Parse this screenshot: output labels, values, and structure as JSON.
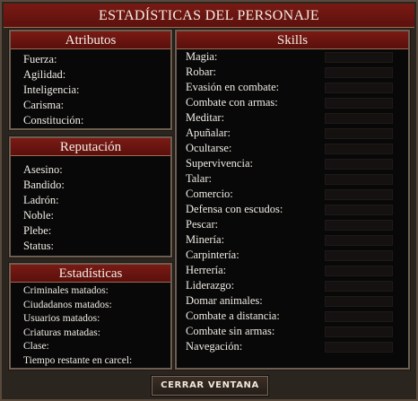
{
  "window": {
    "title": "ESTADÍSTICAS DEL PERSONAJE"
  },
  "attributes": {
    "title": "Atributos",
    "items": [
      {
        "label": "Fuerza:"
      },
      {
        "label": "Agilidad:"
      },
      {
        "label": "Inteligencia:"
      },
      {
        "label": "Carisma:"
      },
      {
        "label": "Constitución:"
      }
    ]
  },
  "reputation": {
    "title": "Reputación",
    "items": [
      {
        "label": "Asesino:"
      },
      {
        "label": "Bandido:"
      },
      {
        "label": "Ladrón:"
      },
      {
        "label": "Noble:"
      },
      {
        "label": "Plebe:"
      },
      {
        "label": "Status:"
      }
    ]
  },
  "statistics": {
    "title": "Estadísticas",
    "items": [
      {
        "label": "Criminales matados:"
      },
      {
        "label": "Ciudadanos matados:"
      },
      {
        "label": "Usuarios matados:"
      },
      {
        "label": "Criaturas matadas:"
      },
      {
        "label": "Clase:"
      },
      {
        "label": "Tiempo restante en carcel:"
      }
    ]
  },
  "skills": {
    "title": "Skills",
    "items": [
      {
        "label": "Magia:"
      },
      {
        "label": "Robar:"
      },
      {
        "label": "Evasión en combate:"
      },
      {
        "label": "Combate con armas:"
      },
      {
        "label": "Meditar:"
      },
      {
        "label": "Apuñalar:"
      },
      {
        "label": "Ocultarse:"
      },
      {
        "label": "Supervivencia:"
      },
      {
        "label": "Talar:"
      },
      {
        "label": "Comercio:"
      },
      {
        "label": "Defensa con escudos:"
      },
      {
        "label": "Pescar:"
      },
      {
        "label": "Minería:"
      },
      {
        "label": "Carpintería:"
      },
      {
        "label": "Herrería:"
      },
      {
        "label": "Liderazgo:"
      },
      {
        "label": "Domar animales:"
      },
      {
        "label": "Combate a distancia:"
      },
      {
        "label": "Combate sin armas:"
      },
      {
        "label": "Navegación:"
      }
    ]
  },
  "close_button": {
    "label": "CERRAR VENTANA"
  },
  "colors": {
    "header_red": "#7a1a14",
    "panel_bg": "#080808",
    "window_bg": "#2b2520",
    "border": "#6e5e50"
  }
}
